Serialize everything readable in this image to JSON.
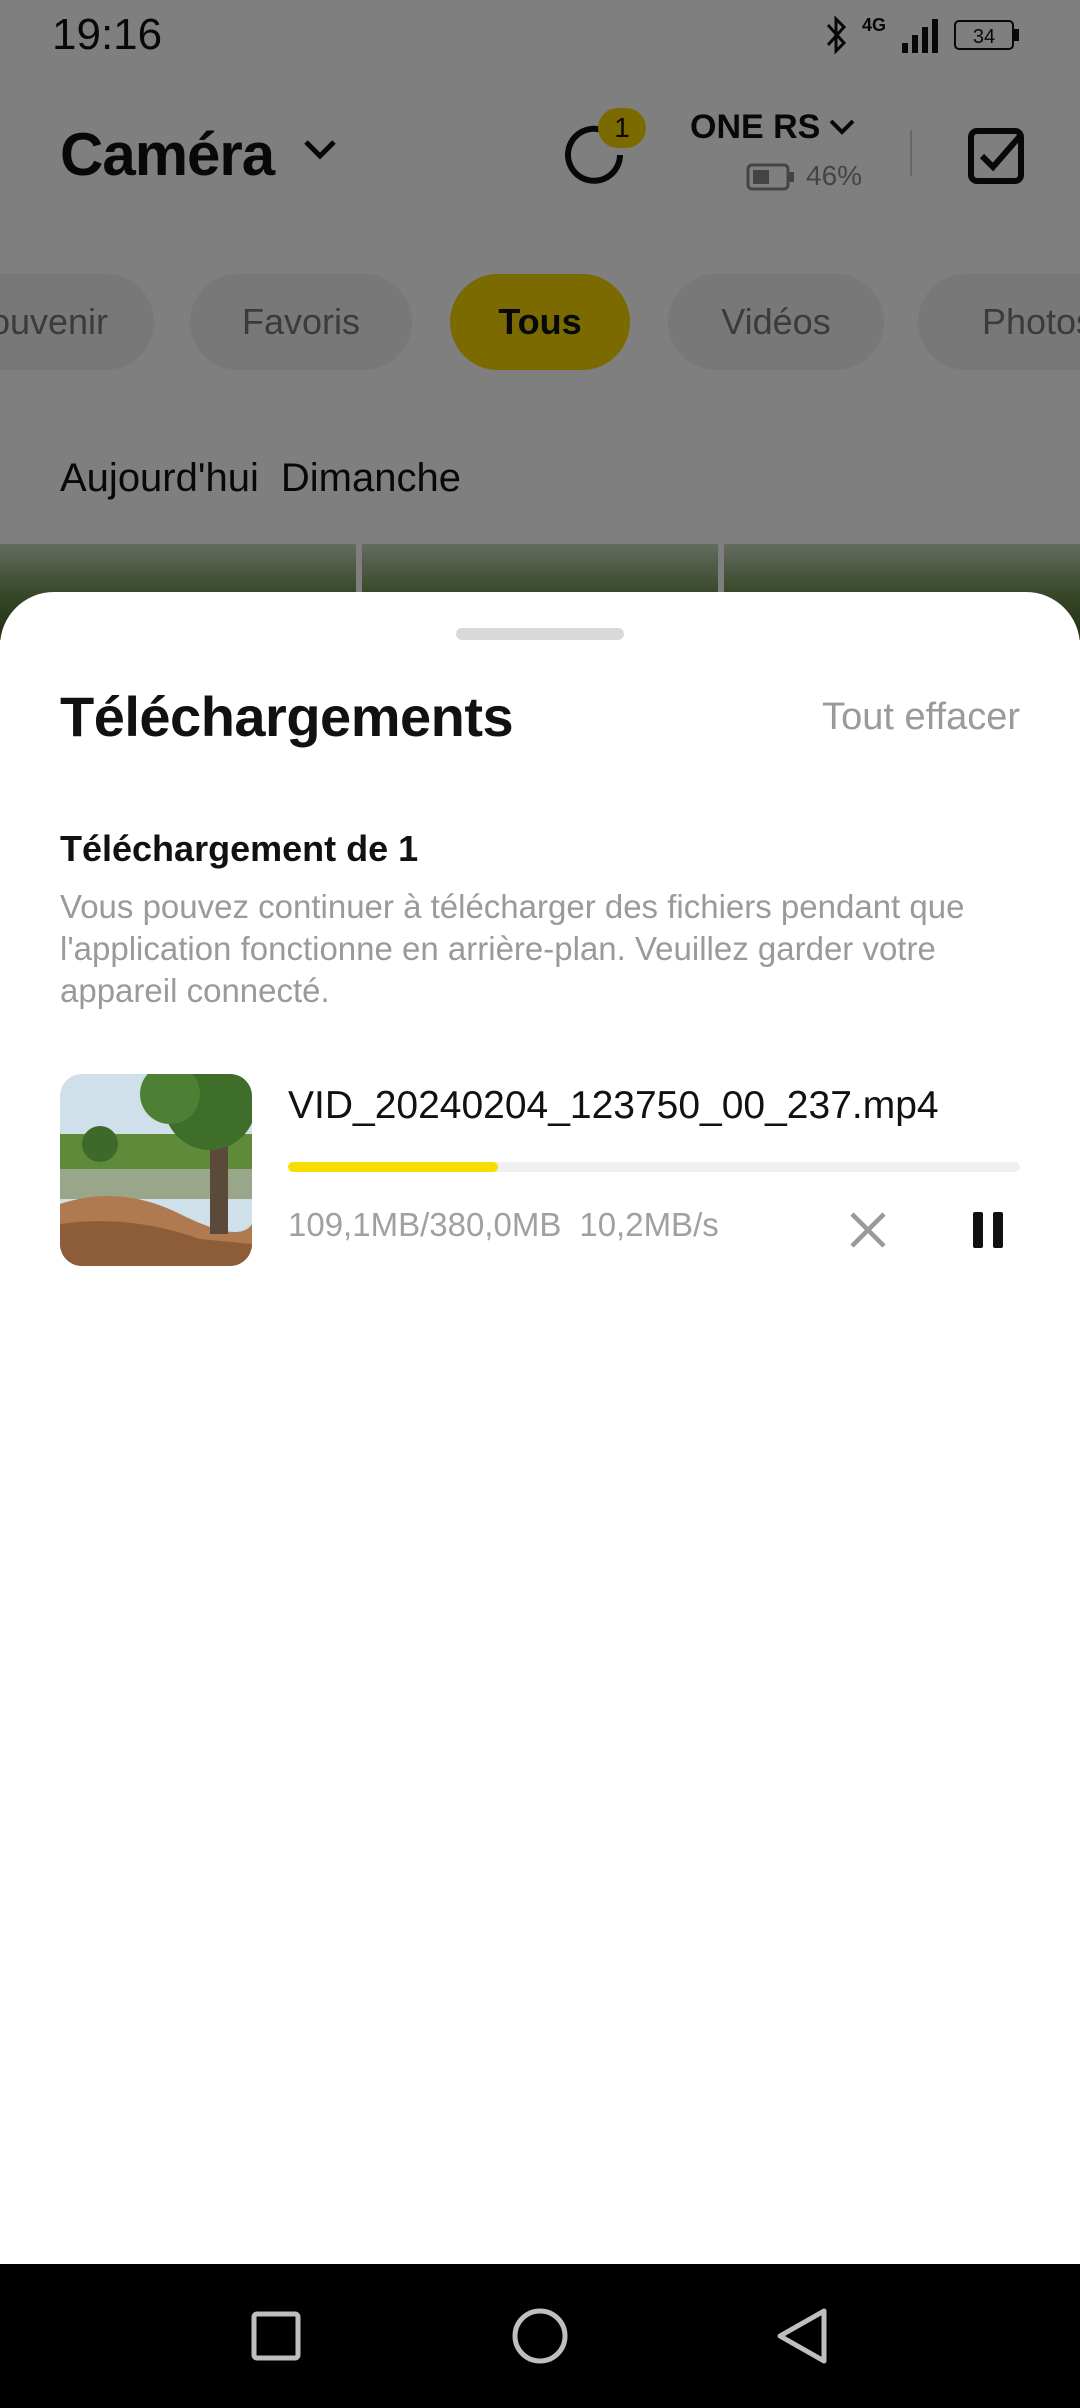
{
  "status_bar": {
    "time": "19:16",
    "network": "4G",
    "battery_level": "34",
    "icons": [
      "bluetooth-icon",
      "signal-icon",
      "battery-icon"
    ]
  },
  "header": {
    "title": "Caméra",
    "sync_badge": "1",
    "device_name": "ONE RS",
    "device_battery": "46%"
  },
  "filter_tabs": [
    {
      "label": "Souvenir",
      "active": false
    },
    {
      "label": "Favoris",
      "active": false
    },
    {
      "label": "Tous",
      "active": true
    },
    {
      "label": "Vidéos",
      "active": false
    },
    {
      "label": "Photos",
      "active": false
    }
  ],
  "date_row": {
    "day": "Aujourd'hui",
    "weekday": "Dimanche"
  },
  "sheet": {
    "title": "Téléchargements",
    "clear_all": "Tout effacer",
    "section_title": "Téléchargement de 1",
    "section_desc": "Vous pouvez continuer à télécharger des fichiers pendant que l'application fonctionne en arrière-plan. Veuillez garder votre appareil connecté.",
    "downloads": [
      {
        "file_name": "VID_20240204_123750_00_237.mp4",
        "downloaded": "109,1MB/380,0MB",
        "speed": "10,2MB/s",
        "progress_fraction": 0.287
      }
    ]
  },
  "colors": {
    "accent": "#f5d400",
    "progress": "#f5de00",
    "muted_text": "#9a9a9a",
    "overlay": "rgba(0,0,0,0.5)"
  },
  "nav_bar": {
    "icons": [
      "recents-icon",
      "home-icon",
      "back-icon"
    ]
  }
}
